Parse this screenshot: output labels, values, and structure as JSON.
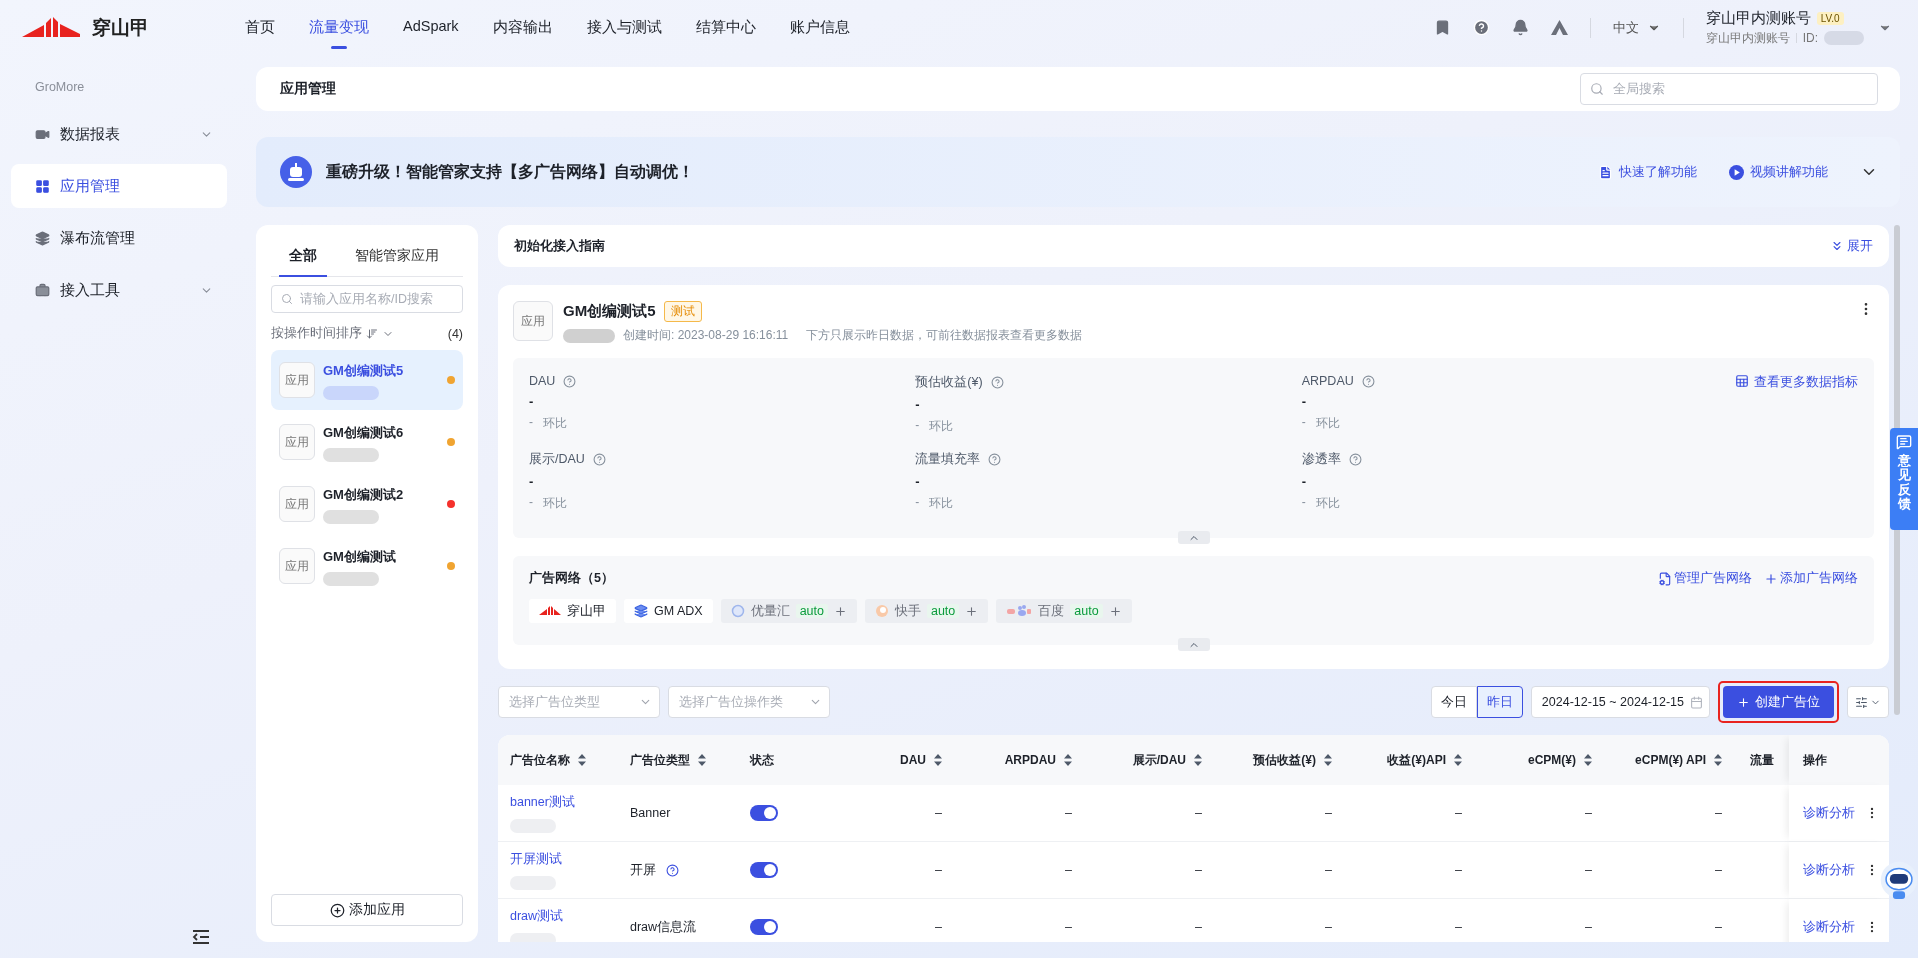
{
  "top_nav": {
    "brand": "穿山甲",
    "items": [
      {
        "label": "首页",
        "selected": false
      },
      {
        "label": "流量变现",
        "selected": true
      },
      {
        "label": "AdSpark",
        "selected": false
      },
      {
        "label": "内容输出",
        "selected": false
      },
      {
        "label": "接入与测试",
        "selected": false
      },
      {
        "label": "结算中心",
        "selected": false
      },
      {
        "label": "账户信息",
        "selected": false
      }
    ],
    "language": "中文",
    "account": {
      "name": "穿山甲内测账号",
      "level": "LV.0",
      "sub_name": "穿山甲内测账号",
      "id_label": "ID:"
    }
  },
  "sidebar": {
    "section": "GroMore",
    "items": [
      {
        "kind": "report",
        "label": "数据报表",
        "selected": false,
        "submenu": true
      },
      {
        "kind": "apps",
        "label": "应用管理",
        "selected": true,
        "submenu": false
      },
      {
        "kind": "waterfall",
        "label": "瀑布流管理",
        "selected": false,
        "submenu": false
      },
      {
        "kind": "tools",
        "label": "接入工具",
        "selected": false,
        "submenu": true
      }
    ]
  },
  "page_header": {
    "title": "应用管理",
    "search": {
      "placeholder": "全局搜索"
    }
  },
  "banner": {
    "title": "重磅升级！智能管家支持【多广告网络】自动调优！",
    "links": [
      {
        "kind": "doc",
        "label": "快速了解功能"
      },
      {
        "kind": "video",
        "label": "视频讲解功能"
      }
    ]
  },
  "app_list": {
    "tabs": [
      {
        "label": "全部",
        "selected": true
      },
      {
        "label": "智能管家应用",
        "selected": false
      }
    ],
    "search": {
      "placeholder": "请输入应用名称/ID搜索"
    },
    "sort_label": "按操作时间排序",
    "count": "(4)",
    "items": [
      {
        "icon_label": "应用",
        "name": "GM创编测试5",
        "selected": true,
        "color": "#f0a431"
      },
      {
        "icon_label": "应用",
        "name": "GM创编测试6",
        "selected": false,
        "color": "#f0a431"
      },
      {
        "icon_label": "应用",
        "name": "GM创编测试2",
        "selected": false,
        "color": "#f5312c"
      },
      {
        "icon_label": "应用",
        "name": "GM创编测试",
        "selected": false,
        "color": "#f0a431"
      }
    ],
    "add_button": "添加应用"
  },
  "guide": {
    "title": "初始化接入指南",
    "toggle": "展开"
  },
  "app_card": {
    "icon_label": "应用",
    "name": "GM创编测试5",
    "tag": "测试",
    "created": "创建时间: 2023-08-29 16:16:11",
    "note": "下方只展示昨日数据，可前往数据报表查看更多数据",
    "more_metrics_link": "查看更多数据指标",
    "metrics": [
      {
        "label": "DAU",
        "value": "-",
        "delta": "-",
        "delta_label": "环比"
      },
      {
        "label": "预估收益(¥)",
        "value": "-",
        "delta": "-",
        "delta_label": "环比"
      },
      {
        "label": "ARPDAU",
        "value": "-",
        "delta": "-",
        "delta_label": "环比"
      },
      {
        "label": "展示/DAU",
        "value": "-",
        "delta": "-",
        "delta_label": "环比"
      },
      {
        "label": "流量填充率",
        "value": "-",
        "delta": "-",
        "delta_label": "环比"
      },
      {
        "label": "渗透率",
        "value": "-",
        "delta": "-",
        "delta_label": "环比"
      }
    ],
    "networks": {
      "title": "广告网络（5）",
      "manage_link": "管理广告网络",
      "add_link": "添加广告网络",
      "items": [
        {
          "kind": "pangle",
          "name": "穿山甲"
        },
        {
          "kind": "gmadx",
          "name": "GM ADX"
        },
        {
          "kind": "ylh",
          "name": "优量汇",
          "tag": "auto"
        },
        {
          "kind": "kuaishou",
          "name": "快手",
          "tag": "auto"
        },
        {
          "kind": "baidu",
          "name": "百度",
          "tag": "auto"
        }
      ]
    }
  },
  "toolbar": {
    "filters": [
      {
        "placeholder": "选择广告位类型"
      },
      {
        "placeholder": "选择广告位操作类"
      }
    ],
    "date_tabs": [
      {
        "label": "今日",
        "selected": false
      },
      {
        "label": "昨日",
        "selected": true
      }
    ],
    "date_range": "2024-12-15 ~ 2024-12-15",
    "create_button": {
      "label": "创建广告位",
      "highlighted": true
    }
  },
  "table": {
    "columns": [
      {
        "label": "广告位名称",
        "sortable": true
      },
      {
        "label": "广告位类型",
        "sortable": true
      },
      {
        "label": "状态",
        "sortable": false
      },
      {
        "label": "DAU",
        "sortable": true
      },
      {
        "label": "ARPDAU",
        "sortable": true
      },
      {
        "label": "展示/DAU",
        "sortable": true
      },
      {
        "label": "预估收益(¥)",
        "sortable": true
      },
      {
        "label": "收益(¥)API",
        "sortable": true
      },
      {
        "label": "eCPM(¥)",
        "sortable": true
      },
      {
        "label": "eCPM(¥) API",
        "sortable": true
      },
      {
        "label": "流量",
        "sortable": false
      }
    ],
    "action_column": "操作",
    "rows": [
      {
        "name": "banner测试",
        "type": "Banner",
        "help": false,
        "on": true,
        "values": [
          "–",
          "–",
          "–",
          "–",
          "–",
          "–",
          "–"
        ],
        "action": "诊断分析"
      },
      {
        "name": "开屏测试",
        "type": "开屏",
        "help": true,
        "on": true,
        "values": [
          "–",
          "–",
          "–",
          "–",
          "–",
          "–",
          "–"
        ],
        "action": "诊断分析"
      },
      {
        "name": "draw测试",
        "type": "draw信息流",
        "help": false,
        "on": true,
        "values": [
          "–",
          "–",
          "–",
          "–",
          "–",
          "–",
          "–"
        ],
        "action": "诊断分析"
      }
    ]
  },
  "feedback": "意见反馈"
}
